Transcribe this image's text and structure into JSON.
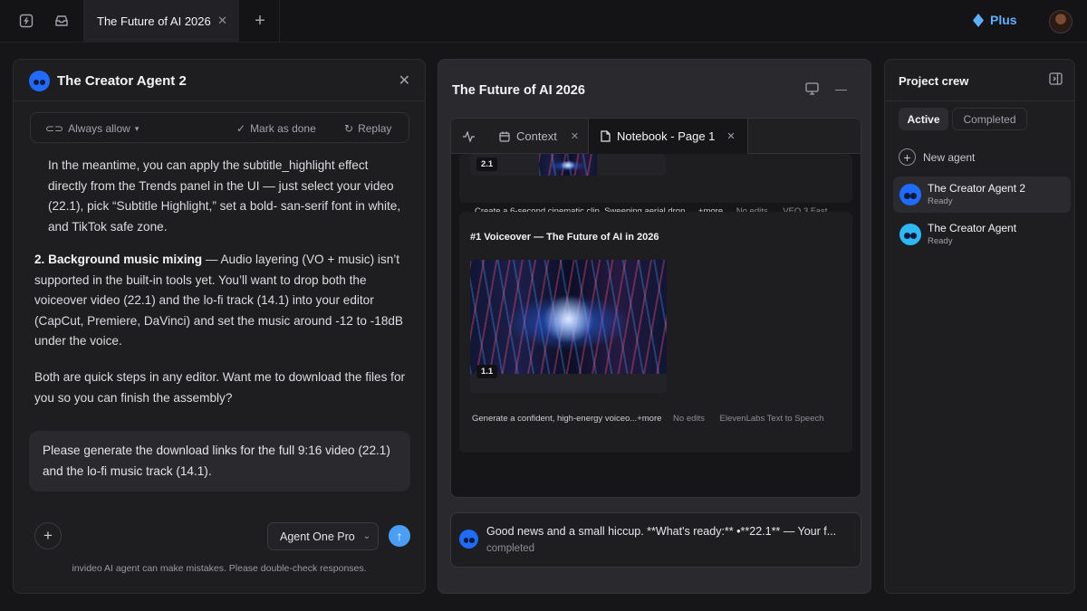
{
  "topbar": {
    "tab_title": "The Future of AI 2026",
    "plan_label": "Plus",
    "accent_color": "#5eb0ff",
    "icons": [
      "sidebar-toggle-icon",
      "inbox-icon",
      "close-icon",
      "plus-icon",
      "diamond-icon",
      "avatar"
    ]
  },
  "chat": {
    "title": "The Creator Agent 2",
    "toolbar": {
      "always_allow": "Always allow",
      "mark_done": "Mark as done",
      "replay": "Replay"
    },
    "msg_intro": "In the meantime, you can apply the subtitle_highlight effect directly from the Trends panel in the UI — just select your video (22.1), pick “Subtitle Highlight,” set a bold- san-serif font in white, and TikTok safe zone.",
    "msg_item_number": "2.",
    "msg_item_heading": "Background music mixing",
    "msg_item_body": " — Audio layering (VO + music) isn’t supported in the built-in tools yet. You’ll want to drop both the voiceover video (22.1) and the lo-fi track (14.1) into your editor (CapCut, Premiere, DaVinci) and set the music around -12 to -18dB under the voice.",
    "msg_outro": "Both are quick steps in any editor. Want me to download the files for you so you can finish the assembly?",
    "user_message": "Please generate the download links for the full 9:16 video (22.1) and the lo-fi music track (14.1).",
    "model": "Agent One Pro",
    "disclaimer": "invideo AI agent can make mistakes. Please double-check responses."
  },
  "project": {
    "title": "The Future of AI 2026",
    "tabs": {
      "context": "Context",
      "notebook": "Notebook - Page 1"
    },
    "cards": [
      {
        "badge": "2.1",
        "prompt": "Create a 6-second cinematic clip. Sweeping aerial dron...",
        "more": "+more",
        "edits": "No edits",
        "model": "VEO 3 Fast"
      },
      {
        "title": "#1 Voiceover — The Future of AI in 2026",
        "badge": "1.1",
        "prompt": "Generate a confident, high-energy voiceo...",
        "more": "+more",
        "edits": "No edits",
        "model": "ElevenLabs Text to Speech"
      }
    ],
    "status": {
      "message": "Good news and a small hiccup. **What's ready:** •**22.1** — Your f...",
      "state": "completed"
    }
  },
  "crew": {
    "title": "Project crew",
    "filters": {
      "active": "Active",
      "completed": "Completed"
    },
    "new_agent": "New agent",
    "agents": [
      {
        "name": "The Creator Agent 2",
        "status": "Ready",
        "color": "#1f6bff"
      },
      {
        "name": "The Creator Agent",
        "status": "Ready",
        "color": "#2cb8f5"
      }
    ]
  }
}
